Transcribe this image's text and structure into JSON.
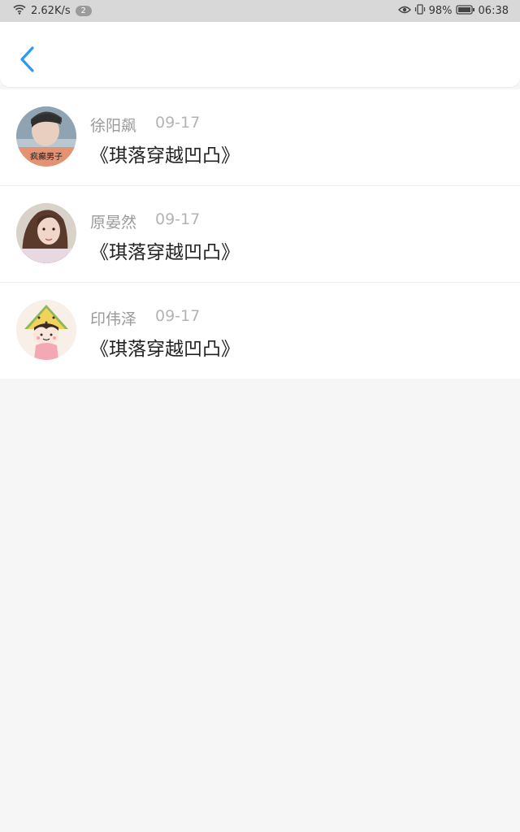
{
  "status_bar": {
    "network_speed": "2.62K/s",
    "notification_count": "2",
    "battery": "98%",
    "time": "06:38",
    "icons": [
      "wifi-icon",
      "eye-icon",
      "vibrate-icon",
      "battery-icon"
    ]
  },
  "header": {
    "back_icon": "chevron-left-icon",
    "accent_color": "#2b9af3"
  },
  "list": [
    {
      "name": "徐阳飙",
      "date": "09-17",
      "title": "《琪落穿越凹凸》",
      "avatar_caption": "疯癫男子"
    },
    {
      "name": "原晏然",
      "date": "09-17",
      "title": "《琪落穿越凹凸》"
    },
    {
      "name": "印伟泽",
      "date": "09-17",
      "title": "《琪落穿越凹凸》"
    }
  ]
}
